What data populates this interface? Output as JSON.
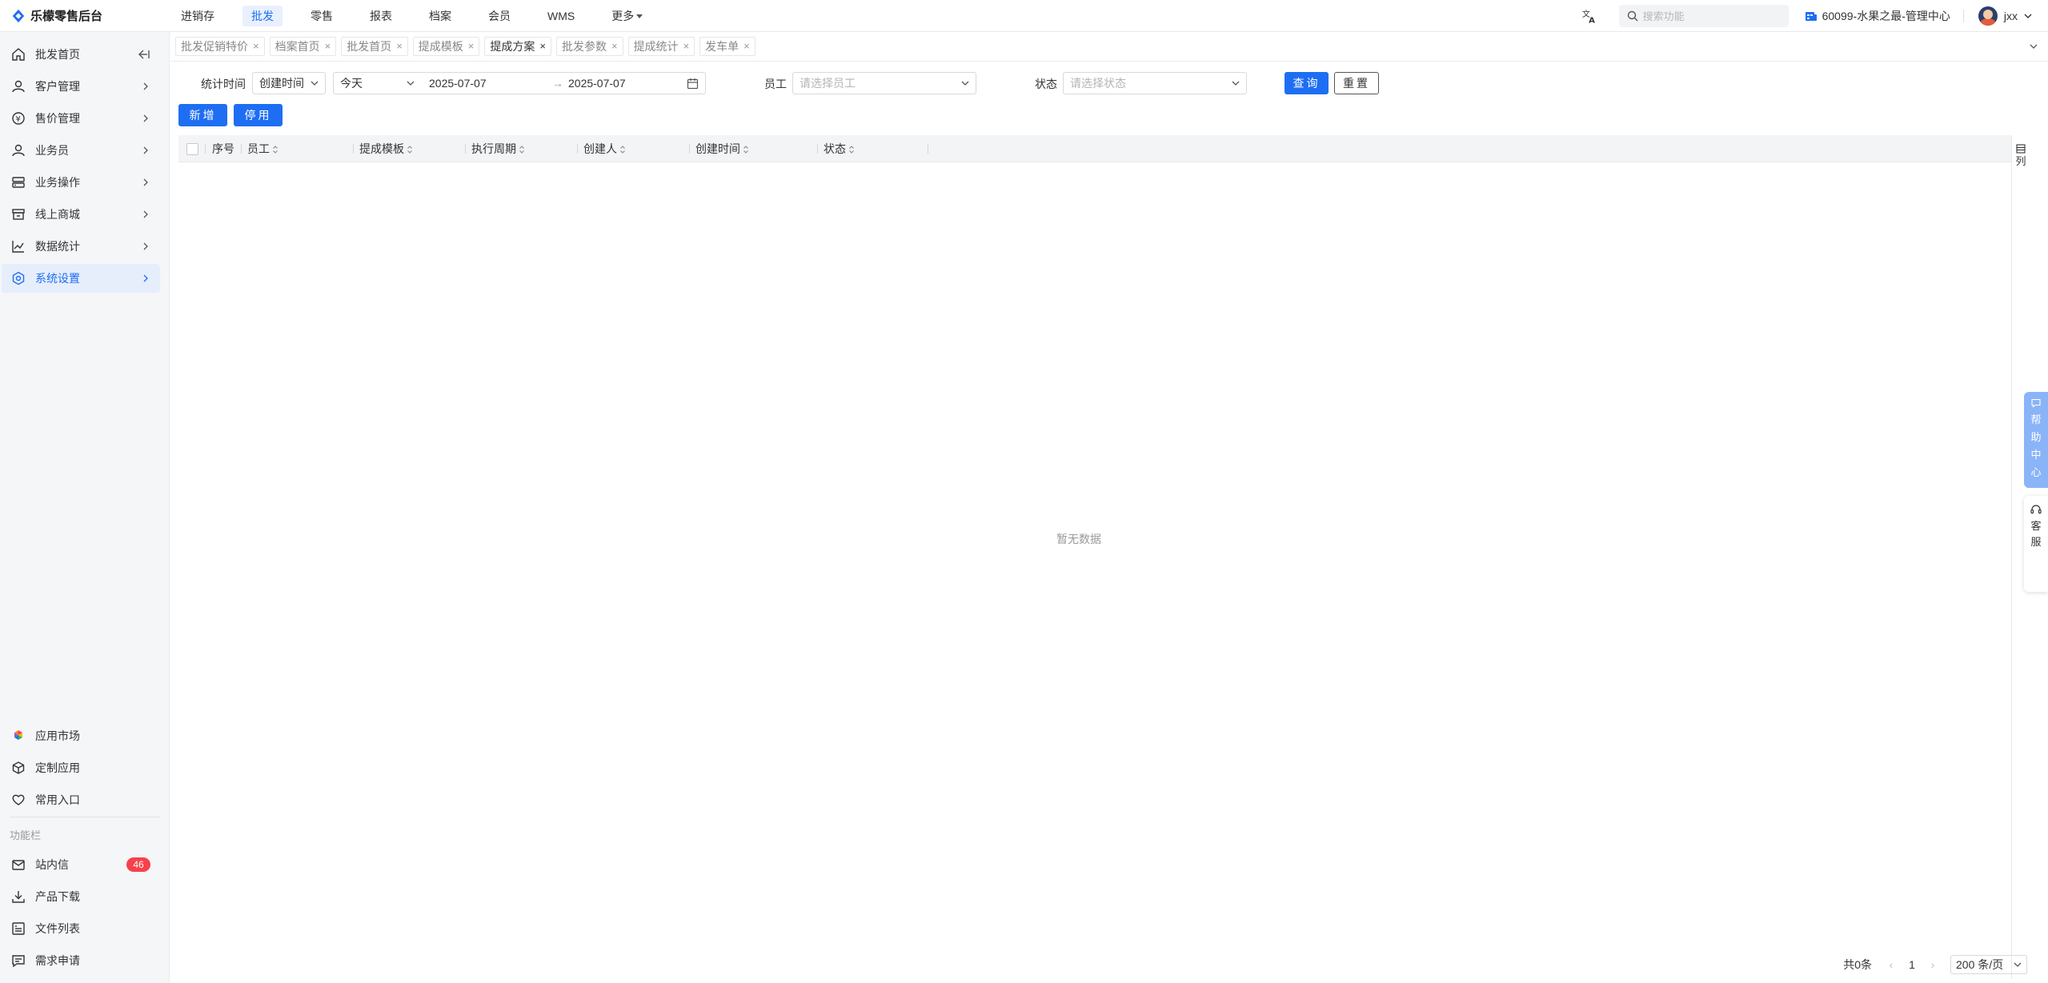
{
  "app": {
    "title": "乐檬零售后台"
  },
  "topnav": {
    "items": [
      "进销存",
      "批发",
      "零售",
      "报表",
      "档案",
      "会员",
      "WMS",
      "更多"
    ],
    "active_index": 1
  },
  "search": {
    "placeholder": "搜索功能"
  },
  "store": {
    "name": "60099-水果之最-管理中心"
  },
  "user": {
    "name": "jxx"
  },
  "sidebar": {
    "items": [
      {
        "label": "批发首页",
        "icon": "home-icon"
      },
      {
        "label": "客户管理",
        "icon": "person-icon"
      },
      {
        "label": "售价管理",
        "icon": "price-icon"
      },
      {
        "label": "业务员",
        "icon": "person-icon"
      },
      {
        "label": "业务操作",
        "icon": "server-icon"
      },
      {
        "label": "线上商城",
        "icon": "store-icon"
      },
      {
        "label": "数据统计",
        "icon": "chart-icon"
      },
      {
        "label": "系统设置",
        "icon": "settings-icon"
      }
    ],
    "active_index": 7,
    "bottom_items": [
      {
        "label": "应用市场",
        "icon": "app-market-icon"
      },
      {
        "label": "定制应用",
        "icon": "cube-icon"
      },
      {
        "label": "常用入口",
        "icon": "heart-icon"
      }
    ],
    "group_label": "功能栏",
    "function_items": [
      {
        "label": "站内信",
        "icon": "mail-icon",
        "badge": "46"
      },
      {
        "label": "产品下载",
        "icon": "download-icon"
      },
      {
        "label": "文件列表",
        "icon": "file-list-icon"
      },
      {
        "label": "需求申请",
        "icon": "request-icon"
      }
    ]
  },
  "tabs": {
    "items": [
      "批发促销特价",
      "档案首页",
      "批发首页",
      "提成模板",
      "提成方案",
      "批发参数",
      "提成统计",
      "发车单"
    ],
    "active_index": 4
  },
  "filters": {
    "stat_time_label": "统计时间",
    "time_type": "创建时间",
    "range_preset": "今天",
    "start_date": "2025-07-07",
    "end_date": "2025-07-07",
    "range_arrow": "→",
    "employee_label": "员工",
    "employee_placeholder": "请选择员工",
    "status_label": "状态",
    "status_placeholder": "请选择状态",
    "query_button": "查询",
    "reset_button": "重置"
  },
  "actions": {
    "add_button": "新增",
    "disable_button": "停用"
  },
  "table": {
    "columns": [
      "序号",
      "员工",
      "提成模板",
      "执行周期",
      "创建人",
      "创建时间",
      "状态"
    ],
    "empty_text": "暂无数据",
    "column_setting_label": "列"
  },
  "help": {
    "help_center": [
      "帮",
      "助",
      "中",
      "心"
    ],
    "service": [
      "客",
      "服"
    ]
  },
  "pagination": {
    "total": "共0条",
    "current_page": "1",
    "page_size": "200 条/页"
  },
  "colors": {
    "primary": "#1e6ef4",
    "badge": "#f5424d",
    "active_bg": "#e6eefc"
  }
}
